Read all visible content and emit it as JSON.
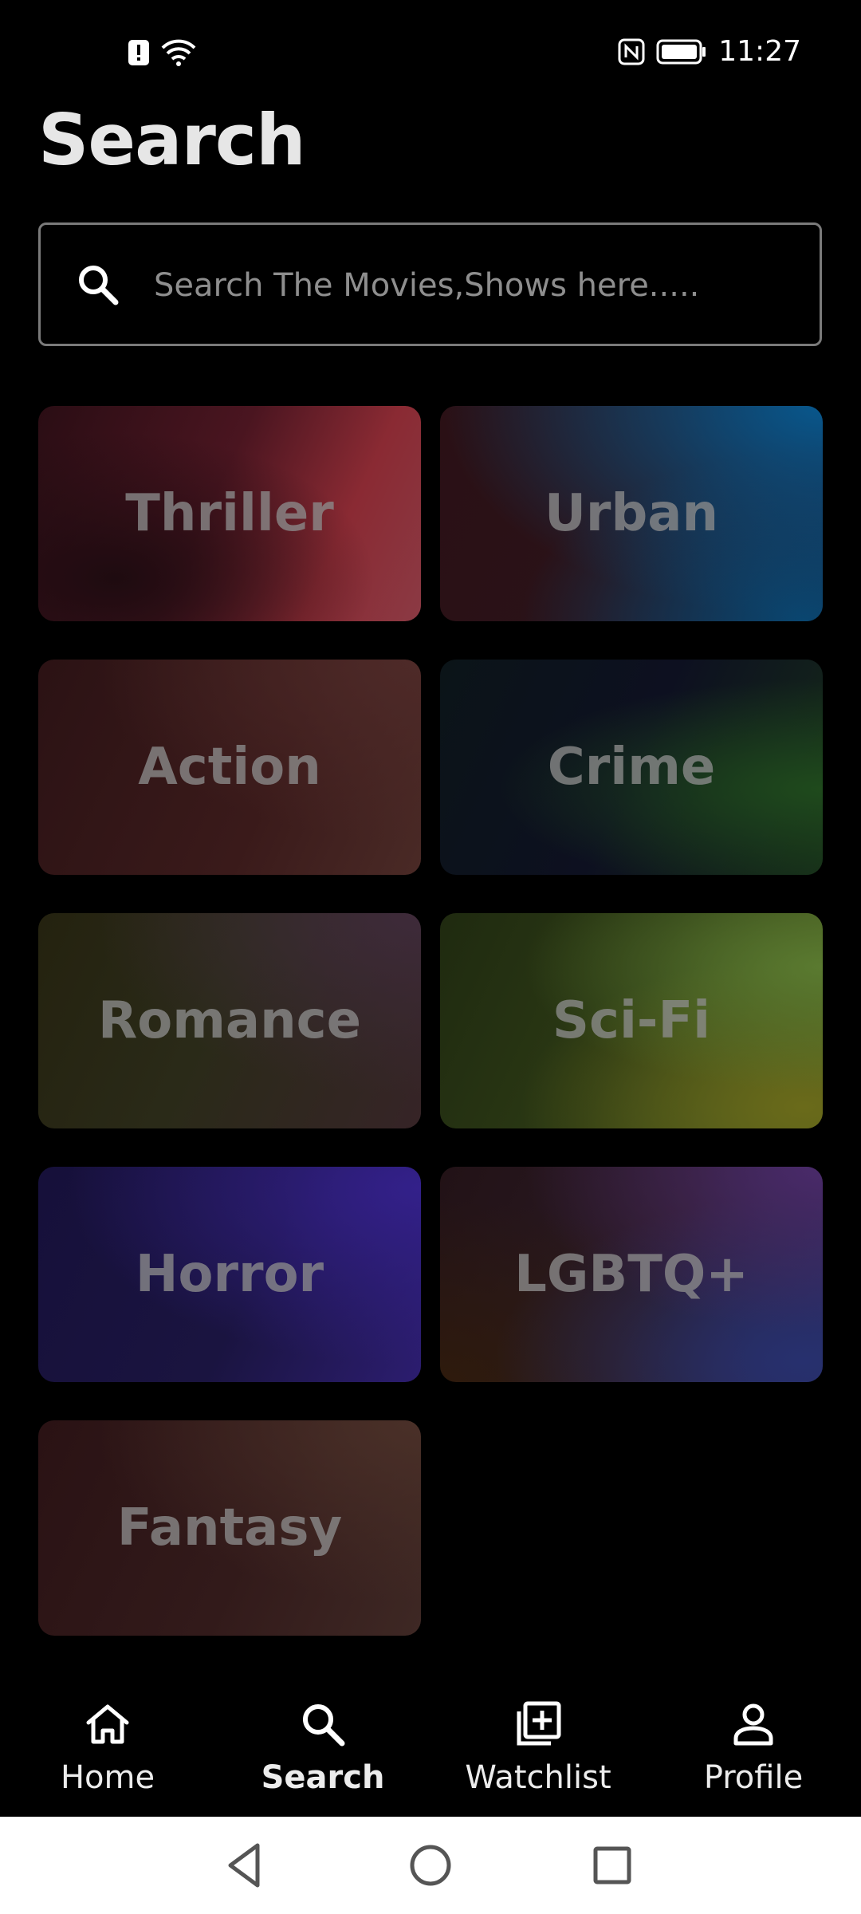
{
  "status_bar": {
    "time": "11:27",
    "left_icons": [
      "alert-icon",
      "wifi-icon"
    ],
    "right_icons": [
      "nfc-icon",
      "battery-icon"
    ]
  },
  "page": {
    "title": "Search"
  },
  "search": {
    "placeholder": "Search The Movies,Shows here.....",
    "value": ""
  },
  "genres": [
    {
      "label": "Thriller"
    },
    {
      "label": "Urban"
    },
    {
      "label": "Action"
    },
    {
      "label": "Crime"
    },
    {
      "label": "Romance"
    },
    {
      "label": "Sci-Fi"
    },
    {
      "label": "Horror"
    },
    {
      "label": "LGBTQ+"
    },
    {
      "label": "Fantasy"
    }
  ],
  "bottom_nav": {
    "items": [
      {
        "label": "Home",
        "icon": "home-icon"
      },
      {
        "label": "Search",
        "icon": "search-icon",
        "active": true
      },
      {
        "label": "Watchlist",
        "icon": "add-to-list-icon"
      },
      {
        "label": "Profile",
        "icon": "profile-icon"
      }
    ]
  },
  "system_nav": {
    "icons": [
      "back-icon",
      "home-circle-icon",
      "recents-icon"
    ]
  }
}
